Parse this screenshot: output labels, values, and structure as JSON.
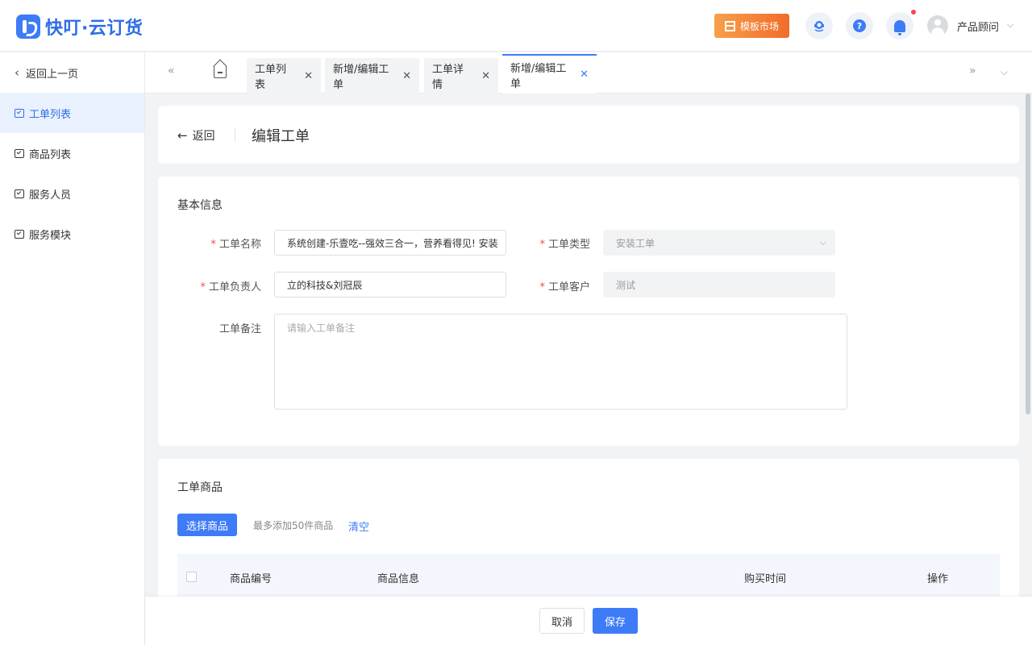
{
  "header": {
    "brand": "快叮·云订货",
    "template_market": "模板市场",
    "user_name": "产品顾问",
    "icons": [
      "support-icon",
      "help-icon",
      "bell-icon",
      "avatar"
    ]
  },
  "sidebar": {
    "back_label": "返回上一页",
    "items": [
      {
        "label": "工单列表",
        "active": true
      },
      {
        "label": "商品列表",
        "active": false
      },
      {
        "label": "服务人员",
        "active": false
      },
      {
        "label": "服务模块",
        "active": false
      }
    ]
  },
  "tabs": [
    {
      "label": "工单列表",
      "active": false
    },
    {
      "label": "新增/编辑工单",
      "active": false
    },
    {
      "label": "工单详情",
      "active": false
    },
    {
      "label": "新增/编辑工单",
      "active": true
    }
  ],
  "page": {
    "back_label": "返回",
    "title": "编辑工单"
  },
  "basic_info": {
    "section_title": "基本信息",
    "name_label": "工单名称",
    "name_value": "系统创建-乐壹吃--强效三合一，营养看得见! 安装",
    "type_label": "工单类型",
    "type_value": "安装工单",
    "owner_label": "工单负责人",
    "owner_value": "立的科技&刘冠辰",
    "customer_label": "工单客户",
    "customer_value": "测试",
    "remark_label": "工单备注",
    "remark_placeholder": "请输入工单备注"
  },
  "goods": {
    "section_title": "工单商品",
    "select_button": "选择商品",
    "hint": "最多添加50件商品",
    "clear_link": "清空",
    "columns": [
      "商品编号",
      "商品信息",
      "购买时间",
      "操作"
    ]
  },
  "footer": {
    "cancel": "取消",
    "save": "保存"
  },
  "colors": {
    "primary": "#3d7bf7",
    "market_orange": "#f26b2a",
    "required": "#f5474d"
  }
}
